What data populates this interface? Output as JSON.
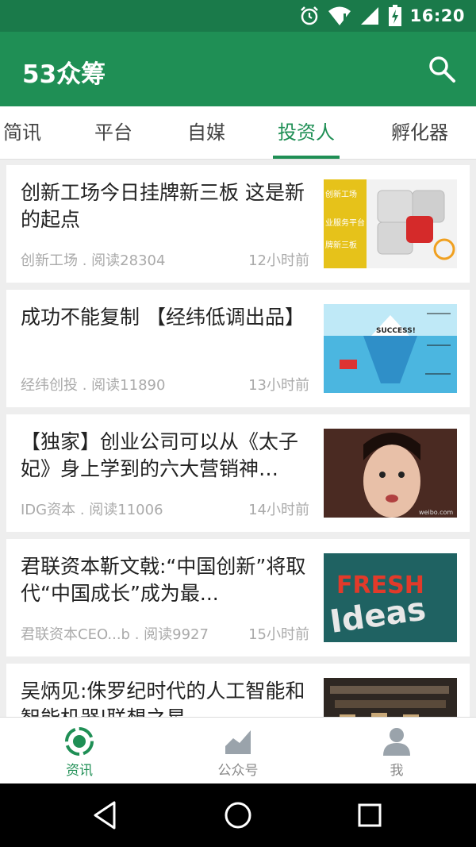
{
  "status_bar": {
    "time": "16:20"
  },
  "app_bar": {
    "title": "53众筹"
  },
  "tabs": [
    {
      "label": "简讯",
      "active": false
    },
    {
      "label": "平台",
      "active": false
    },
    {
      "label": "自媒",
      "active": false
    },
    {
      "label": "投资人",
      "active": true
    },
    {
      "label": "孵化器",
      "active": false
    }
  ],
  "articles": [
    {
      "title": "创新工场今日挂牌新三板 这是新的起点",
      "source": "创新工场 . 阅读28304",
      "time": "12小时前",
      "thumb_text": "创新工场\n业服务平台\n牌新三板"
    },
    {
      "title": "成功不能复制 【经纬低调出品】",
      "source": "经纬创投 . 阅读11890",
      "time": "13小时前",
      "thumb_text": "SUCCESS!"
    },
    {
      "title": "【独家】创业公司可以从《太子妃》身上学到的六大营销神…",
      "source": "IDG资本 . 阅读11006",
      "time": "14小时前",
      "thumb_text": "weibo.com"
    },
    {
      "title": "君联资本靳文戟:“中国创新”将取代“中国成长”成为最...",
      "source": "君联资本CEO...b . 阅读9927",
      "time": "15小时前",
      "thumb_text": "FRESH Ideas"
    },
    {
      "title": "吴炳见:侏罗纪时代的人工智能和智能机器|联想之星",
      "source": "",
      "time": "",
      "thumb_text": ""
    }
  ],
  "bottom_nav": [
    {
      "label": "资讯",
      "icon": "news-icon",
      "active": true
    },
    {
      "label": "公众号",
      "icon": "chart-icon",
      "active": false
    },
    {
      "label": "我",
      "icon": "person-icon",
      "active": false
    }
  ],
  "colors": {
    "primary": "#1f8f55",
    "status_bar": "#1a7a4a"
  }
}
